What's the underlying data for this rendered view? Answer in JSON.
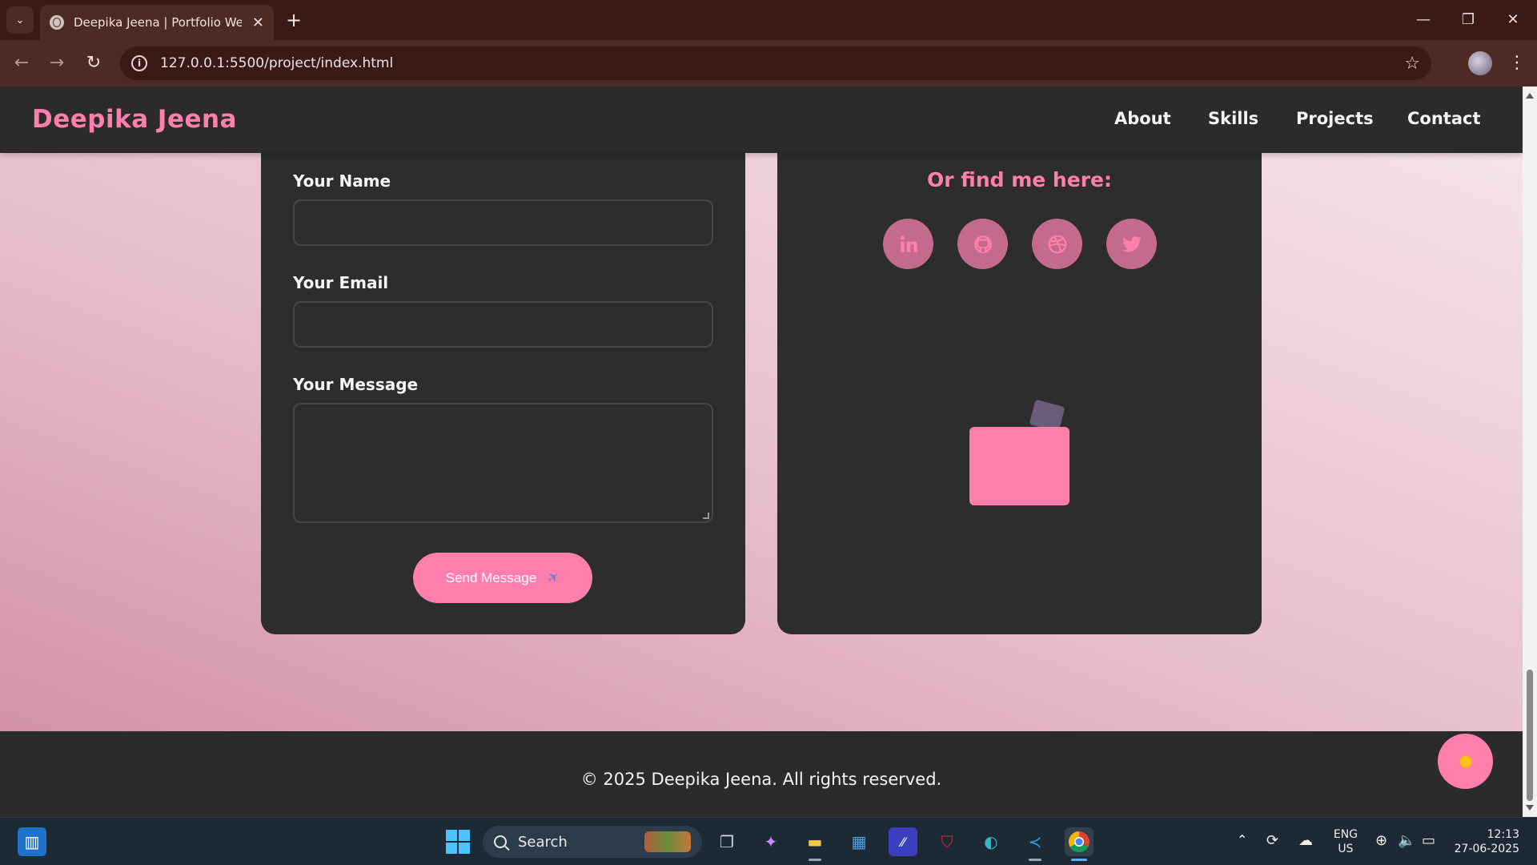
{
  "browser": {
    "tab_title": "Deepika Jeena | Portfolio Website",
    "url": "127.0.0.1:5500/project/index.html"
  },
  "site": {
    "logo": "Deepika Jeena",
    "nav": [
      "About",
      "Skills",
      "Projects",
      "Contact"
    ]
  },
  "contact_form": {
    "name_label": "Your Name",
    "name_value": "",
    "email_label": "Your Email",
    "email_value": "",
    "message_label": "Your Message",
    "message_value": "",
    "send_label": "Send Message"
  },
  "social": {
    "title": "Or find me here:",
    "links": [
      {
        "name": "linkedin-icon"
      },
      {
        "name": "github-icon"
      },
      {
        "name": "dribbble-icon"
      },
      {
        "name": "twitter-icon"
      }
    ]
  },
  "footer": {
    "copyright": "© 2025 Deepika Jeena. All rights reserved."
  },
  "taskbar": {
    "search_label": "Search",
    "lang_top": "ENG",
    "lang_bottom": "US",
    "time": "12:13",
    "date": "27-06-2025"
  },
  "colors": {
    "accent": "#ff7fac",
    "surface": "#2d2d2d",
    "chrome": "#4e2a24"
  }
}
